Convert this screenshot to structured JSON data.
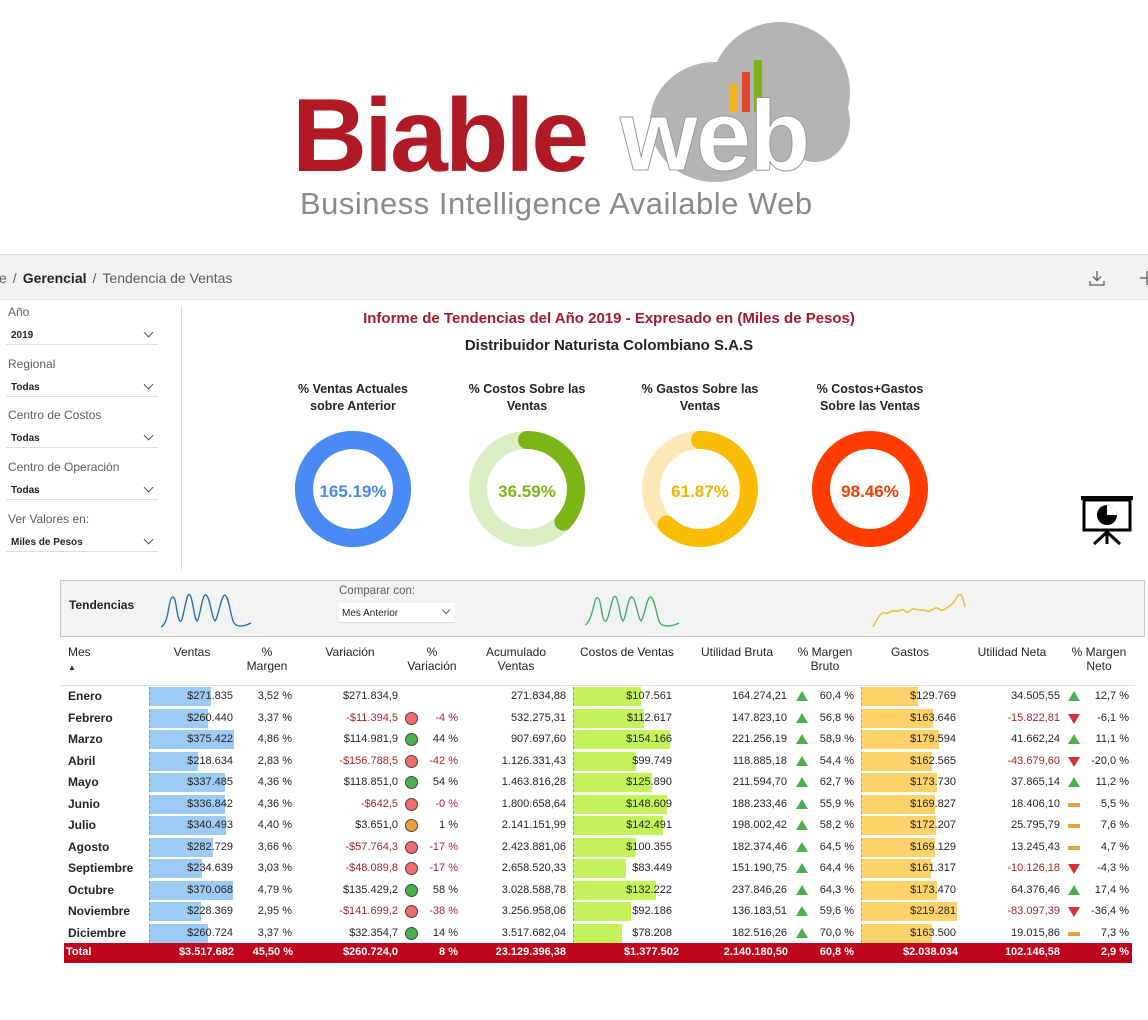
{
  "logo": {
    "name_red": "Biable",
    "name_grey": "web",
    "tagline": "Business Intelligence Available Web"
  },
  "breadcrumb": {
    "items": [
      "e",
      "Gerencial",
      "Tendencia de Ventas"
    ]
  },
  "filters": [
    {
      "label": "Año",
      "value": "2019"
    },
    {
      "label": "Regional",
      "value": "Todas"
    },
    {
      "label": "Centro de Costos",
      "value": "Todas"
    },
    {
      "label": "Centro de Operación",
      "value": "Todas"
    },
    {
      "label": "Ver Valores en:",
      "value": "Miles de Pesos"
    }
  ],
  "report": {
    "title": "Informe de Tendencias del Año 2019 - Expresado en (Miles de Pesos)",
    "subtitle": "Distribuidor Naturista Colombiano S.A.S"
  },
  "kpis": [
    {
      "label_1": "% Ventas Actuales",
      "label_2": "sobre Anterior",
      "value_text": "165.19%",
      "fraction": 1.0,
      "color": "#4a8af4",
      "track": "#4a8af4"
    },
    {
      "label_1": "% Costos Sobre las",
      "label_2": "Ventas",
      "value_text": "36.59%",
      "fraction": 0.3659,
      "color": "#7cb518",
      "track": "#dcefc4"
    },
    {
      "label_1": "% Gastos Sobre las",
      "label_2": "Ventas",
      "value_text": "61.87%",
      "fraction": 0.6187,
      "color": "#fbbc05",
      "track": "#fde9b8"
    },
    {
      "label_1": "% Costos+Gastos",
      "label_2": "Sobre las Ventas",
      "value_text": "98.46%",
      "fraction": 0.9846,
      "color": "#ff3d00",
      "track": "#ffd2c2"
    }
  ],
  "trends": {
    "label": "Tendencias",
    "compare_label": "Comparar con:",
    "compare_value": "Mes Anterior",
    "colors": [
      "#2f6fb0",
      "#3cb371",
      "#e3c229"
    ]
  },
  "table": {
    "headers": {
      "mes": "Mes",
      "ventas": "Ventas",
      "margen_1": "%",
      "margen_2": "Margen",
      "variacion": "Variación",
      "pvar_1": "%",
      "pvar_2": "Variación",
      "acum_1": "Acumulado",
      "acum_2": "Ventas",
      "costos": "Costos de Ventas",
      "utilidad_bruta": "Utilidad Bruta",
      "mbruto_1": "% Margen",
      "mbruto_2": "Bruto",
      "gastos": "Gastos",
      "utilidad_neta": "Utilidad Neta",
      "mneto_1": "% Margen",
      "mneto_2": "Neto"
    },
    "rows": [
      {
        "mes": "Enero",
        "ventas": "$271.835",
        "ventas_v": 271835,
        "margen": "3,52 %",
        "variacion": "$271.834,9",
        "var_neg": false,
        "pvar": "",
        "pvar_neg": false,
        "pvar_status": "none",
        "acumulado": "271.834,88",
        "costos": "$107.561",
        "costos_v": 107561,
        "ub": "164.274,21",
        "mb_status": "up",
        "mb": "60,4 %",
        "gastos": "$129.769",
        "gastos_v": 129769,
        "un": "34.505,55",
        "un_neg": false,
        "mn_status": "up",
        "mn": "12,7 %"
      },
      {
        "mes": "Febrero",
        "ventas": "$260.440",
        "ventas_v": 260440,
        "margen": "3,37 %",
        "variacion": "-$11.394,5",
        "var_neg": true,
        "pvar": "-4 %",
        "pvar_neg": true,
        "pvar_status": "red",
        "acumulado": "532.275,31",
        "costos": "$112.617",
        "costos_v": 112617,
        "ub": "147.823,10",
        "mb_status": "up",
        "mb": "56,8 %",
        "gastos": "$163.646",
        "gastos_v": 163646,
        "un": "-15.822,81",
        "un_neg": true,
        "mn_status": "down",
        "mn": "-6,1 %"
      },
      {
        "mes": "Marzo",
        "ventas": "$375.422",
        "ventas_v": 375422,
        "margen": "4,86 %",
        "variacion": "$114.981,9",
        "var_neg": false,
        "pvar": "44 %",
        "pvar_neg": false,
        "pvar_status": "green",
        "acumulado": "907.697,60",
        "costos": "$154.166",
        "costos_v": 154166,
        "ub": "221.256,19",
        "mb_status": "up",
        "mb": "58,9 %",
        "gastos": "$179.594",
        "gastos_v": 179594,
        "un": "41.662,24",
        "un_neg": false,
        "mn_status": "up",
        "mn": "11,1 %"
      },
      {
        "mes": "Abril",
        "ventas": "$218.634",
        "ventas_v": 218634,
        "margen": "2,83 %",
        "variacion": "-$156.788,5",
        "var_neg": true,
        "pvar": "-42 %",
        "pvar_neg": true,
        "pvar_status": "red",
        "acumulado": "1.126.331,43",
        "costos": "$99.749",
        "costos_v": 99749,
        "ub": "118.885,18",
        "mb_status": "up",
        "mb": "54,4 %",
        "gastos": "$162.565",
        "gastos_v": 162565,
        "un": "-43.679,60",
        "un_neg": true,
        "mn_status": "down",
        "mn": "-20,0 %"
      },
      {
        "mes": "Mayo",
        "ventas": "$337.485",
        "ventas_v": 337485,
        "margen": "4,36 %",
        "variacion": "$118.851,0",
        "var_neg": false,
        "pvar": "54 %",
        "pvar_neg": false,
        "pvar_status": "green",
        "acumulado": "1.463.816,28",
        "costos": "$125.890",
        "costos_v": 125890,
        "ub": "211.594,70",
        "mb_status": "up",
        "mb": "62,7 %",
        "gastos": "$173.730",
        "gastos_v": 173730,
        "un": "37.865,14",
        "un_neg": false,
        "mn_status": "up",
        "mn": "11,2 %"
      },
      {
        "mes": "Junio",
        "ventas": "$336.842",
        "ventas_v": 336842,
        "margen": "4,36 %",
        "variacion": "-$642,5",
        "var_neg": true,
        "pvar": "-0 %",
        "pvar_neg": true,
        "pvar_status": "red",
        "acumulado": "1.800.658,64",
        "costos": "$148.609",
        "costos_v": 148609,
        "ub": "188.233,46",
        "mb_status": "up",
        "mb": "55,9 %",
        "gastos": "$169.827",
        "gastos_v": 169827,
        "un": "18.406,10",
        "un_neg": false,
        "mn_status": "flat",
        "mn": "5,5 %"
      },
      {
        "mes": "Julio",
        "ventas": "$340.493",
        "ventas_v": 340493,
        "margen": "4,40 %",
        "variacion": "$3.651,0",
        "var_neg": false,
        "pvar": "1 %",
        "pvar_neg": false,
        "pvar_status": "orange",
        "acumulado": "2.141.151,99",
        "costos": "$142.491",
        "costos_v": 142491,
        "ub": "198.002,42",
        "mb_status": "up",
        "mb": "58,2 %",
        "gastos": "$172.207",
        "gastos_v": 172207,
        "un": "25.795,79",
        "un_neg": false,
        "mn_status": "flat",
        "mn": "7,6 %"
      },
      {
        "mes": "Agosto",
        "ventas": "$282.729",
        "ventas_v": 282729,
        "margen": "3,66 %",
        "variacion": "-$57.764,3",
        "var_neg": true,
        "pvar": "-17 %",
        "pvar_neg": true,
        "pvar_status": "red",
        "acumulado": "2.423.881,06",
        "costos": "$100.355",
        "costos_v": 100355,
        "ub": "182.374,46",
        "mb_status": "up",
        "mb": "64,5 %",
        "gastos": "$169.129",
        "gastos_v": 169129,
        "un": "13.245,43",
        "un_neg": false,
        "mn_status": "flat",
        "mn": "4,7 %"
      },
      {
        "mes": "Septiembre",
        "ventas": "$234.639",
        "ventas_v": 234639,
        "margen": "3,03 %",
        "variacion": "-$48.089,8",
        "var_neg": true,
        "pvar": "-17 %",
        "pvar_neg": true,
        "pvar_status": "red",
        "acumulado": "2.658.520,33",
        "costos": "$83.449",
        "costos_v": 83449,
        "ub": "151.190,75",
        "mb_status": "up",
        "mb": "64,4 %",
        "gastos": "$161.317",
        "gastos_v": 161317,
        "un": "-10.126,18",
        "un_neg": true,
        "mn_status": "down",
        "mn": "-4,3 %"
      },
      {
        "mes": "Octubre",
        "ventas": "$370.068",
        "ventas_v": 370068,
        "margen": "4,79 %",
        "variacion": "$135.429,2",
        "var_neg": false,
        "pvar": "58 %",
        "pvar_neg": false,
        "pvar_status": "green",
        "acumulado": "3.028.588,78",
        "costos": "$132.222",
        "costos_v": 132222,
        "ub": "237.846,26",
        "mb_status": "up",
        "mb": "64,3 %",
        "gastos": "$173.470",
        "gastos_v": 173470,
        "un": "64.376,46",
        "un_neg": false,
        "mn_status": "up",
        "mn": "17,4 %"
      },
      {
        "mes": "Noviembre",
        "ventas": "$228.369",
        "ventas_v": 228369,
        "margen": "2,95 %",
        "variacion": "-$141.699,2",
        "var_neg": true,
        "pvar": "-38 %",
        "pvar_neg": true,
        "pvar_status": "red",
        "acumulado": "3.256.958,06",
        "costos": "$92.186",
        "costos_v": 92186,
        "ub": "136.183,51",
        "mb_status": "up",
        "mb": "59,6 %",
        "gastos": "$219.281",
        "gastos_v": 219281,
        "un": "-83.097,39",
        "un_neg": true,
        "mn_status": "down",
        "mn": "-36,4 %"
      },
      {
        "mes": "Diciembre",
        "ventas": "$260.724",
        "ventas_v": 260724,
        "margen": "3,37 %",
        "variacion": "$32.354,7",
        "var_neg": false,
        "pvar": "14 %",
        "pvar_neg": false,
        "pvar_status": "green",
        "acumulado": "3.517.682,04",
        "costos": "$78.208",
        "costos_v": 78208,
        "ub": "182.516,26",
        "mb_status": "up",
        "mb": "70,0 %",
        "gastos": "$163.500",
        "gastos_v": 163500,
        "un": "19.015,86",
        "un_neg": false,
        "mn_status": "flat",
        "mn": "7,3 %"
      }
    ],
    "total": {
      "mes": "Total",
      "ventas": "$3.517.682",
      "margen": "45,50 %",
      "variacion": "$260.724,0",
      "pvar": "8 %",
      "acumulado": "23.129.396,38",
      "costos": "$1.377.502",
      "ub": "2.140.180,50",
      "mb": "60,8 %",
      "gastos": "$2.038.034",
      "un": "102.146,58",
      "mn": "2,9 %"
    },
    "bar_colors": {
      "ventas": "#9ccbf5",
      "costos": "#c4f25a",
      "gastos": "#fdd26a"
    },
    "status_colors": {
      "red": "#f26b6b",
      "green": "#4caf50",
      "orange": "#e8a23c"
    }
  }
}
